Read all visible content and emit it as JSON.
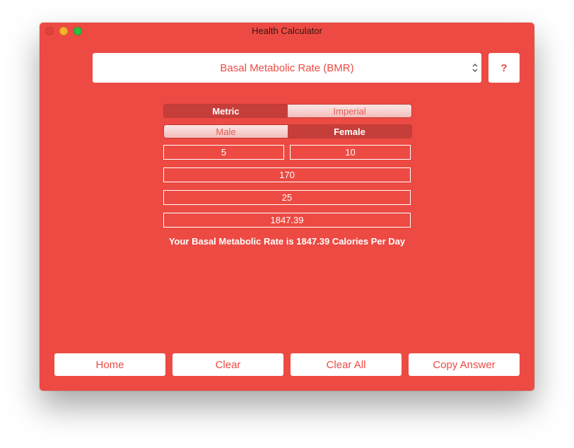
{
  "window": {
    "title": "Health Calculator"
  },
  "calculator_select": {
    "selected": "Basal Metabolic Rate (BMR)"
  },
  "help_button": {
    "label": "?"
  },
  "unit_toggle": {
    "options": [
      "Metric",
      "Imperial"
    ],
    "selected": "Metric"
  },
  "gender_toggle": {
    "options": [
      "Male",
      "Female"
    ],
    "selected": "Female"
  },
  "inputs": {
    "height_feet": "5",
    "height_inches": "10",
    "weight": "170",
    "age": "25",
    "result": "1847.39"
  },
  "result_message": "Your Basal Metabolic Rate is 1847.39 Calories Per Day",
  "buttons": {
    "home": "Home",
    "clear": "Clear",
    "clear_all": "Clear All",
    "copy_answer": "Copy Answer"
  },
  "colors": {
    "background": "#ec4a43",
    "segment_active": "#c63e39",
    "button_face": "#ffffff"
  }
}
